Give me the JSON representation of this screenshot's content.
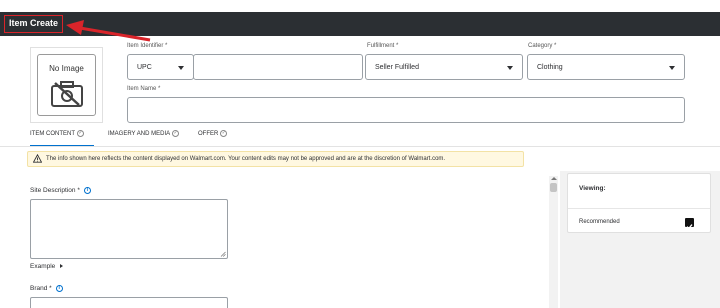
{
  "header": {
    "title": "Item Create"
  },
  "image_placeholder": {
    "label": "No Image",
    "icon": "no-image-icon"
  },
  "form": {
    "item_identifier": {
      "label": "Item Identifier *",
      "type_value": "UPC",
      "value": ""
    },
    "fulfillment": {
      "label": "Fulfillment *",
      "value": "Seller Fulfilled"
    },
    "category": {
      "label": "Category *",
      "value": "Clothing"
    },
    "item_name": {
      "label": "Item Name *",
      "value": ""
    }
  },
  "tabs": [
    {
      "label": "ITEM CONTENT",
      "active": true
    },
    {
      "label": "IMAGERY AND MEDIA",
      "active": false
    },
    {
      "label": "OFFER",
      "active": false
    }
  ],
  "notice": {
    "text": "The info shown here reflects the content displayed on Walmart.com. Your content edits may not be approved and are at the discretion of Walmart.com."
  },
  "content": {
    "site_description": {
      "label": "Site Description *",
      "value": ""
    },
    "example_label": "Example",
    "brand": {
      "label": "Brand *"
    }
  },
  "viewing_panel": {
    "title": "Viewing:",
    "option": "Recommended",
    "checked": true
  },
  "colors": {
    "header_bg": "#2b2f33",
    "annotation_red": "#d9242a",
    "accent_blue": "#0071ce",
    "notice_bg": "#fff8e1"
  }
}
